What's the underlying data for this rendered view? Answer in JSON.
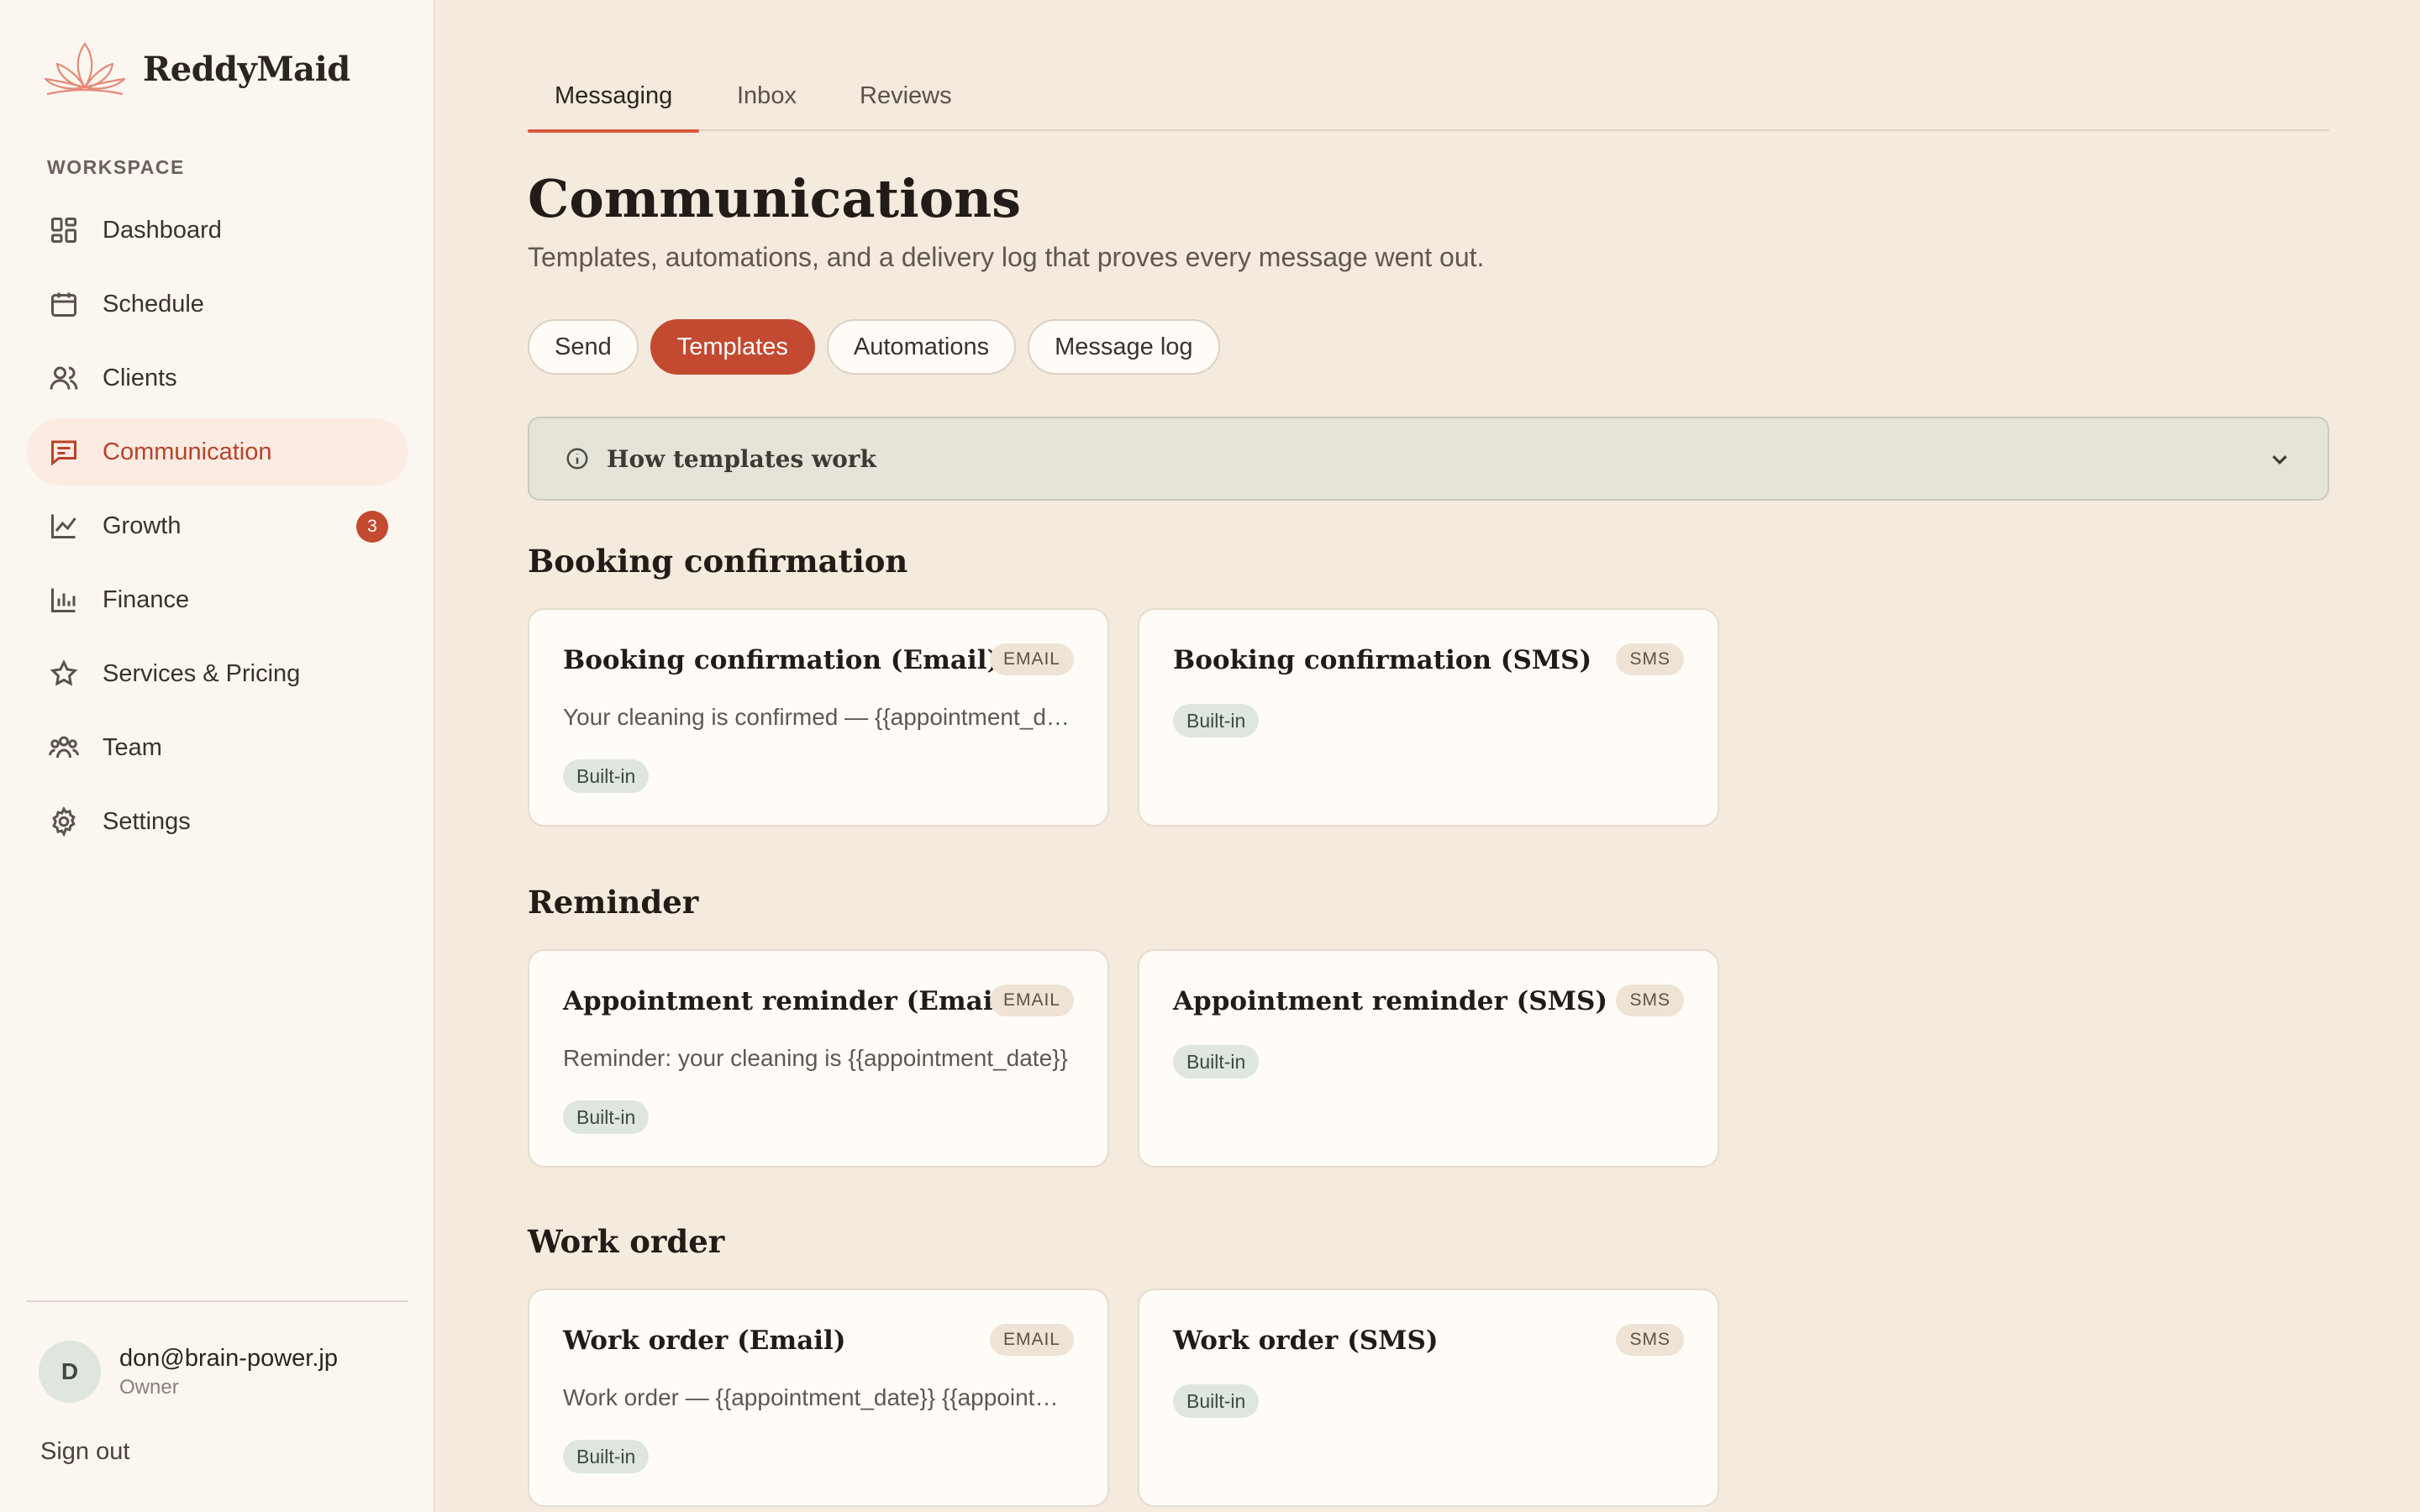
{
  "brand": {
    "name": "ReddyMaid",
    "accent": "#c34a30"
  },
  "sidebar": {
    "section_label": "WORKSPACE",
    "items": [
      {
        "label": "Dashboard",
        "icon": "dashboard-icon"
      },
      {
        "label": "Schedule",
        "icon": "calendar-icon"
      },
      {
        "label": "Clients",
        "icon": "users-icon"
      },
      {
        "label": "Communication",
        "icon": "message-icon",
        "active": true
      },
      {
        "label": "Growth",
        "icon": "chart-line-icon",
        "badge": "3"
      },
      {
        "label": "Finance",
        "icon": "bar-chart-icon"
      },
      {
        "label": "Services & Pricing",
        "icon": "star-icon"
      },
      {
        "label": "Team",
        "icon": "team-icon"
      },
      {
        "label": "Settings",
        "icon": "gear-icon"
      }
    ],
    "user": {
      "initial": "D",
      "email": "don@brain-power.jp",
      "role": "Owner"
    },
    "signout": "Sign out"
  },
  "top_tabs": [
    {
      "label": "Messaging",
      "active": true
    },
    {
      "label": "Inbox"
    },
    {
      "label": "Reviews"
    }
  ],
  "page": {
    "title": "Communications",
    "subtitle": "Templates, automations, and a delivery log that proves every message went out."
  },
  "pills": [
    {
      "label": "Send"
    },
    {
      "label": "Templates",
      "active": true
    },
    {
      "label": "Automations"
    },
    {
      "label": "Message log"
    }
  ],
  "info": {
    "label": "How templates work",
    "icon": "info-icon"
  },
  "groups": [
    {
      "title": "Booking confirmation",
      "cards": [
        {
          "title": "Booking confirmation (Email)",
          "type": "EMAIL",
          "preview": "Your cleaning is confirmed — {{appointment_date}}",
          "tag": "Built-in"
        },
        {
          "title": "Booking confirmation (SMS)",
          "type": "SMS",
          "preview": "",
          "tag": "Built-in"
        }
      ]
    },
    {
      "title": "Reminder",
      "cards": [
        {
          "title": "Appointment reminder (Email)",
          "type": "EMAIL",
          "preview": "Reminder: your cleaning is {{appointment_date}}",
          "tag": "Built-in"
        },
        {
          "title": "Appointment reminder (SMS)",
          "type": "SMS",
          "preview": "",
          "tag": "Built-in"
        }
      ]
    },
    {
      "title": "Work order",
      "cards": [
        {
          "title": "Work order (Email)",
          "type": "EMAIL",
          "preview": "Work order — {{appointment_date}} {{appointment_time}}",
          "tag": "Built-in"
        },
        {
          "title": "Work order (SMS)",
          "type": "SMS",
          "preview": "",
          "tag": "Built-in"
        }
      ]
    }
  ]
}
